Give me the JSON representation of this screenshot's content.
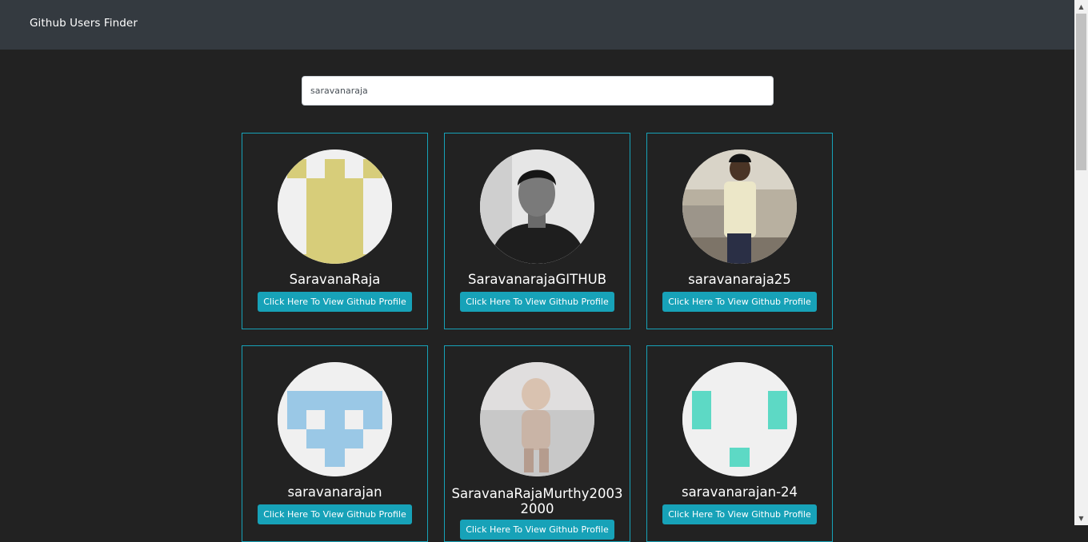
{
  "navbar": {
    "brand": "Github Users Finder"
  },
  "search": {
    "value": "saravanaraja"
  },
  "users": [
    {
      "login": "SaravanaRaja",
      "button_label": "Click Here To View Github Profile"
    },
    {
      "login": "SaravanarajaGITHUB",
      "button_label": "Click Here To View Github Profile"
    },
    {
      "login": "saravanaraja25",
      "button_label": "Click Here To View Github Profile"
    },
    {
      "login": "saravanarajan",
      "button_label": "Click Here To View Github Profile"
    },
    {
      "login": "SaravanaRajaMurthy20032000",
      "button_label": "Click Here To View Github Profile"
    },
    {
      "login": "saravanarajan-24",
      "button_label": "Click Here To View Github Profile"
    }
  ],
  "colors": {
    "navbar": "#343a40",
    "background": "#222222",
    "accent": "#17a2b8"
  }
}
